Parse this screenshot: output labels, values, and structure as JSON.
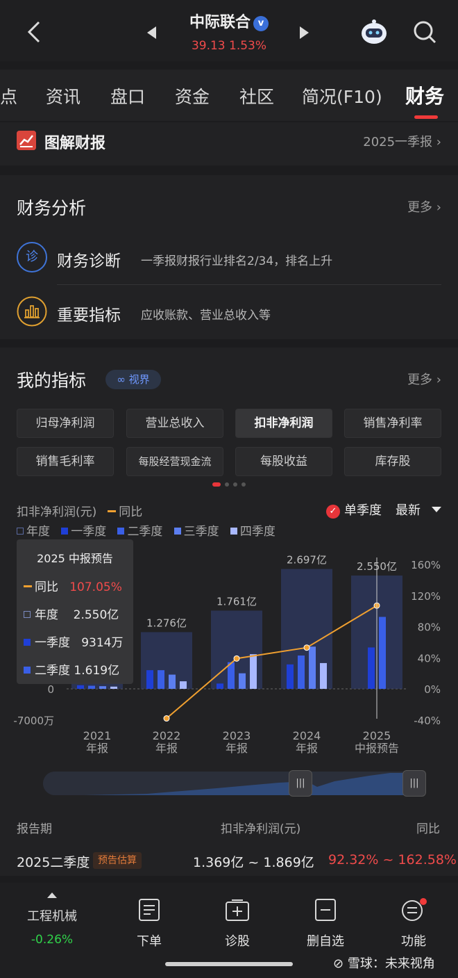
{
  "header": {
    "stock_name": "中际联合",
    "price_line": "39.13 1.53%",
    "verified_glyph": "v"
  },
  "tabs": [
    {
      "label": "点"
    },
    {
      "label": "资讯"
    },
    {
      "label": "盘口"
    },
    {
      "label": "资金"
    },
    {
      "label": "社区"
    },
    {
      "label": "简况(F10)"
    },
    {
      "label": "财务",
      "active": true
    }
  ],
  "report_card": {
    "title": "图解财报",
    "period": "2025一季报"
  },
  "analysis": {
    "title": "财务分析",
    "more": "更多",
    "rows": [
      {
        "icon_text": "诊",
        "title": "财务诊断",
        "subtitle": "一季报财报行业排名2/34，排名上升"
      },
      {
        "title": "重要指标",
        "subtitle": "应收账款、营业总收入等"
      }
    ]
  },
  "indicators": {
    "title": "我的指标",
    "badge": "视界",
    "more": "更多",
    "chips": [
      "归母净利润",
      "营业总收入",
      "扣非净利润",
      "销售净利率",
      "销售毛利率",
      "每股经营现金流",
      "每股收益",
      "库存股"
    ],
    "active_chip": 2
  },
  "chart_header": {
    "metric_label": "扣非净利润(元)",
    "yoy_label": "同比",
    "single_quarter": "单季度",
    "check_glyph": "✓",
    "latest": "最新",
    "legend": [
      "年度",
      "一季度",
      "二季度",
      "三季度",
      "四季度"
    ]
  },
  "tooltip": {
    "title": "2025 中报预告",
    "rows": [
      {
        "label": "同比",
        "value": "107.05%"
      },
      {
        "label": "年度",
        "value": "2.550亿"
      },
      {
        "label": "一季度",
        "value": "9314万"
      },
      {
        "label": "二季度",
        "value": "1.619亿"
      }
    ]
  },
  "colors": {
    "annual": "#2f3b66",
    "q1": "#1f3fd6",
    "q2": "#3a5fe6",
    "q3": "#5c7ef0",
    "q4": "#a9b8ff",
    "yoy": "#f0a030",
    "up": "#f04b4b",
    "down": "#30d24a"
  },
  "chart_data": {
    "type": "bar",
    "categories": [
      "2021\n年报",
      "2022\n年报",
      "2023\n年报",
      "2024\n年报",
      "2025\n中报预告"
    ],
    "annual_labels": [
      "",
      "1.276亿",
      "1.761亿",
      "2.697亿",
      "2.550亿"
    ],
    "annual": [
      0.15,
      1.276,
      1.761,
      2.697,
      2.55
    ],
    "series": [
      {
        "name": "一季度",
        "values": [
          0.08,
          0.42,
          0.12,
          0.55,
          0.9314
        ]
      },
      {
        "name": "二季度",
        "values": [
          0.07,
          0.42,
          0.6,
          0.75,
          1.619
        ]
      },
      {
        "name": "三季度",
        "values": [
          0.06,
          0.32,
          0.35,
          0.95,
          null
        ]
      },
      {
        "name": "四季度",
        "values": [
          0.05,
          0.17,
          0.78,
          0.58,
          null
        ]
      }
    ],
    "yoy": [
      null,
      -38,
      39,
      53,
      107.05
    ],
    "left_ticks": [
      "0",
      "-7000万"
    ],
    "right_ticks": [
      "160%",
      "120%",
      "80%",
      "40%",
      "0%",
      "-40%"
    ],
    "ylim_left": [
      -0.7,
      2.8
    ],
    "ylim_right": [
      -40,
      160
    ]
  },
  "table": {
    "headers": [
      "报告期",
      "扣非净利润(元)",
      "同比"
    ],
    "row": {
      "period": "2025二季度",
      "badge": "预告估算",
      "value": "1.369亿 ~ 1.869亿",
      "yoy": "92.32% ~ 162.58%"
    }
  },
  "bottom_nav": {
    "sector": "工程机械",
    "sector_change": "-0.26%",
    "items": [
      "下单",
      "诊股",
      "删自选",
      "功能"
    ]
  },
  "watermark": "雪球：未来视角"
}
